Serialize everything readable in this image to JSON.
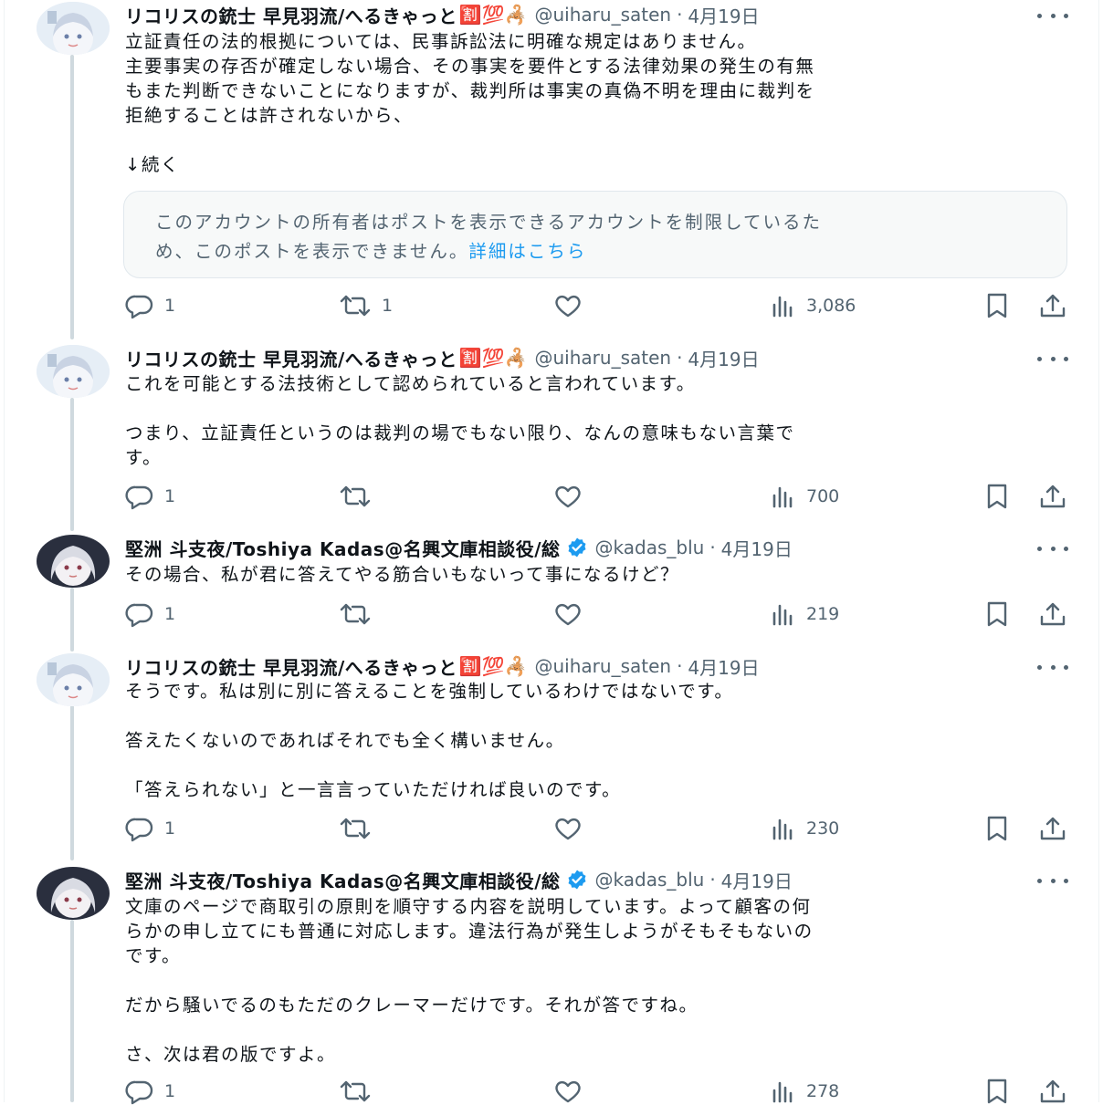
{
  "posts": [
    {
      "author": "リコリスの銃士 早見羽流/へるきゃっと",
      "emoji": "🈹💯🦂",
      "handle": "@uiharu_saten",
      "date": "4月19日",
      "paragraphs": [
        "立証責任の法的根拠については、民事訴訟法に明確な規定はありません。",
        "主要事実の存否が確定しない場合、その事実を要件とする法律効果の発生の有無",
        "もまた判断できないことになりますが、裁判所は事実の真偽不明を理由に裁判を",
        "拒絶することは許されないから、",
        "",
        "↓続く"
      ],
      "notice": {
        "text_line1": "このアカウントの所有者はポストを表示できるアカウントを制限しているた",
        "text_line2": "め、このポストを表示できません。",
        "link": "詳細はこちら"
      },
      "replies": "1",
      "reposts": "1",
      "likes": "",
      "views": "3,086",
      "verified": false
    },
    {
      "author": "リコリスの銃士 早見羽流/へるきゃっと",
      "emoji": "🈹💯🦂",
      "handle": "@uiharu_saten",
      "date": "4月19日",
      "paragraphs": [
        "これを可能とする法技術として認められていると言われています。",
        "",
        "つまり、立証責任というのは裁判の場でもない限り、なんの意味もない言葉で",
        "す。"
      ],
      "replies": "1",
      "reposts": "",
      "likes": "",
      "views": "700",
      "verified": false
    },
    {
      "author": "堅洲 斗支夜/Toshiya Kadas@名興文庫相談役/総",
      "emoji": "",
      "handle": "@kadas_blu",
      "date": "4月19日",
      "paragraphs": [
        "その場合、私が君に答えてやる筋合いもないって事になるけど？"
      ],
      "replies": "1",
      "reposts": "",
      "likes": "",
      "views": "219",
      "verified": true
    },
    {
      "author": "リコリスの銃士 早見羽流/へるきゃっと",
      "emoji": "🈹💯🦂",
      "handle": "@uiharu_saten",
      "date": "4月19日",
      "paragraphs": [
        "そうです。私は別に別に答えることを強制しているわけではないです。",
        "",
        "答えたくないのであればそれでも全く構いません。",
        "",
        "「答えられない」と一言言っていただければ良いのです。"
      ],
      "replies": "1",
      "reposts": "",
      "likes": "",
      "views": "230",
      "verified": false
    },
    {
      "author": "堅洲 斗支夜/Toshiya Kadas@名興文庫相談役/総",
      "emoji": "",
      "handle": "@kadas_blu",
      "date": "4月19日",
      "paragraphs": [
        "文庫のページで商取引の原則を順守する内容を説明しています。よって顧客の何",
        "らかの申し立てにも普通に対応します。違法行為が発生しようがそもそもないの",
        "です。",
        "",
        "だから騒いでるのもただのクレーマーだけです。それが答ですね。",
        "",
        "さ、次は君の版ですよ。"
      ],
      "replies": "1",
      "reposts": "",
      "likes": "",
      "views": "278",
      "verified": true
    }
  ],
  "colors": {
    "text": "#0f1419",
    "muted": "#536471",
    "link": "#1d9bf0",
    "verified": "#1d9bf0",
    "thread": "#cfd9de"
  }
}
